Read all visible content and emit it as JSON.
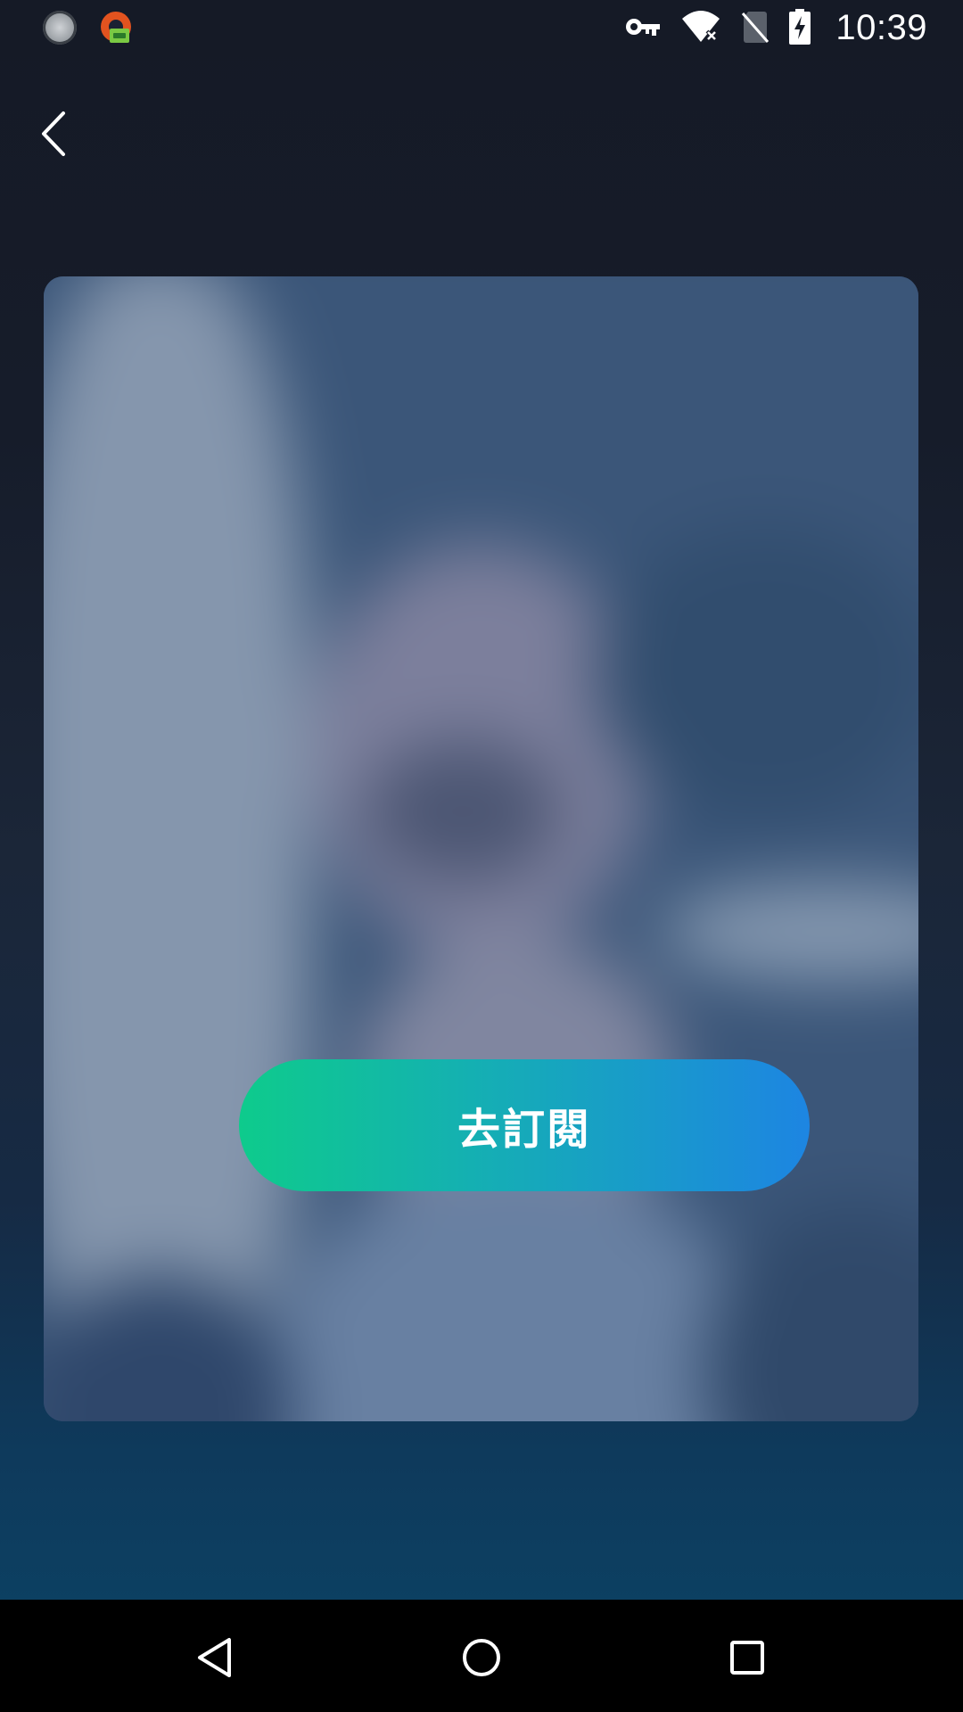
{
  "status_bar": {
    "time": "10:39",
    "left_icons": [
      "sync-app-icon",
      "vpn-app-icon"
    ],
    "right_icons": [
      "vpn-key-icon",
      "wifi-icon",
      "no-sim-icon",
      "battery-charging-icon"
    ]
  },
  "header": {
    "back_icon": "chevron-left-icon"
  },
  "main": {
    "subscribe_button_label": "去訂閱"
  },
  "nav_bar": {
    "icons": [
      "back-triangle-icon",
      "home-circle-icon",
      "recents-square-icon"
    ]
  },
  "colors": {
    "button_gradient_start": "#0ecb8c",
    "button_gradient_end": "#1d85e2",
    "background_dark": "#151a26",
    "background_bottom": "#0b4466"
  }
}
